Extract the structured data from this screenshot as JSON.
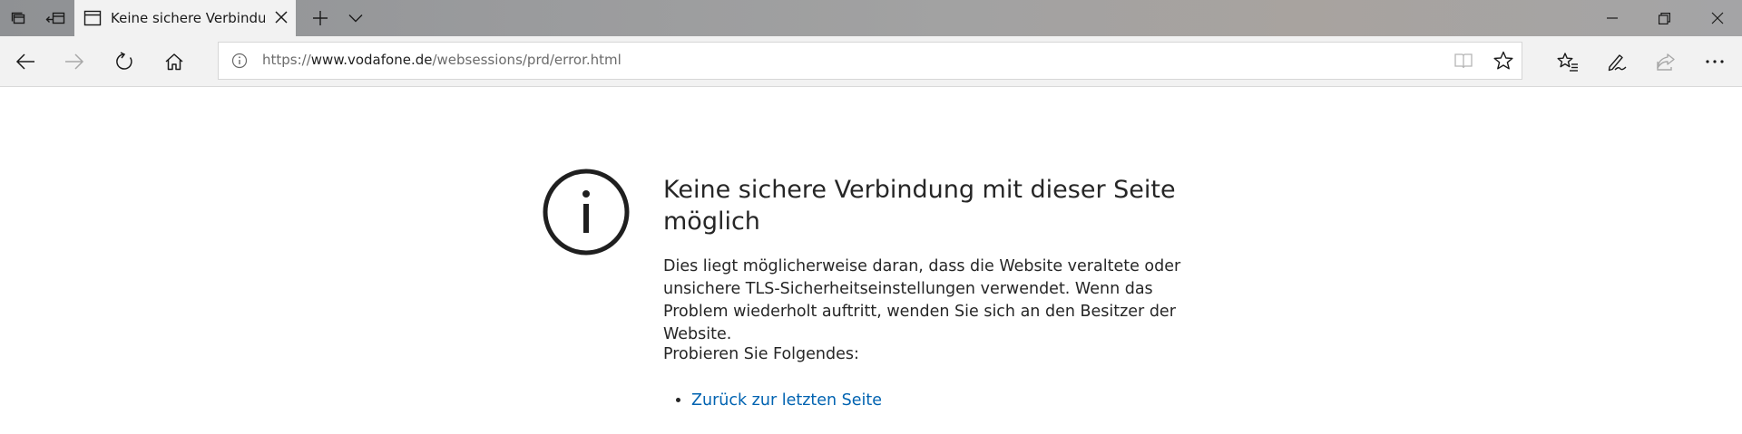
{
  "window": {
    "tab_title": "Keine sichere Verbindur",
    "controls": {
      "minimize_icon": "minimize-icon",
      "restore_icon": "restore-icon",
      "close_icon": "close-icon"
    }
  },
  "toolbar": {
    "icons": [
      "back-icon",
      "forward-icon",
      "refresh-icon",
      "home-icon",
      "reading-view-icon",
      "favorite-star-icon",
      "favorites-hub-icon",
      "pen-icon",
      "share-icon",
      "more-icon"
    ]
  },
  "address": {
    "url_prefix": "https://",
    "url_host": "www.vodafone.de",
    "url_path": "/websessions/prd/error.html"
  },
  "error": {
    "title": "Keine sichere Verbindung mit dieser Seite möglich",
    "description": "Dies liegt möglicherweise daran, dass die Website veraltete oder unsichere TLS-Sicherheitseinstellungen verwendet. Wenn das Problem wiederholt auftritt, wenden Sie sich an den Besitzer der Website.",
    "try_heading": "Probieren Sie Folgendes:",
    "suggestions": [
      "Zurück zur letzten Seite"
    ]
  },
  "colors": {
    "link": "#0063b1",
    "titlebar": "#9a9b9d",
    "toolbar": "#f2f2f2"
  }
}
